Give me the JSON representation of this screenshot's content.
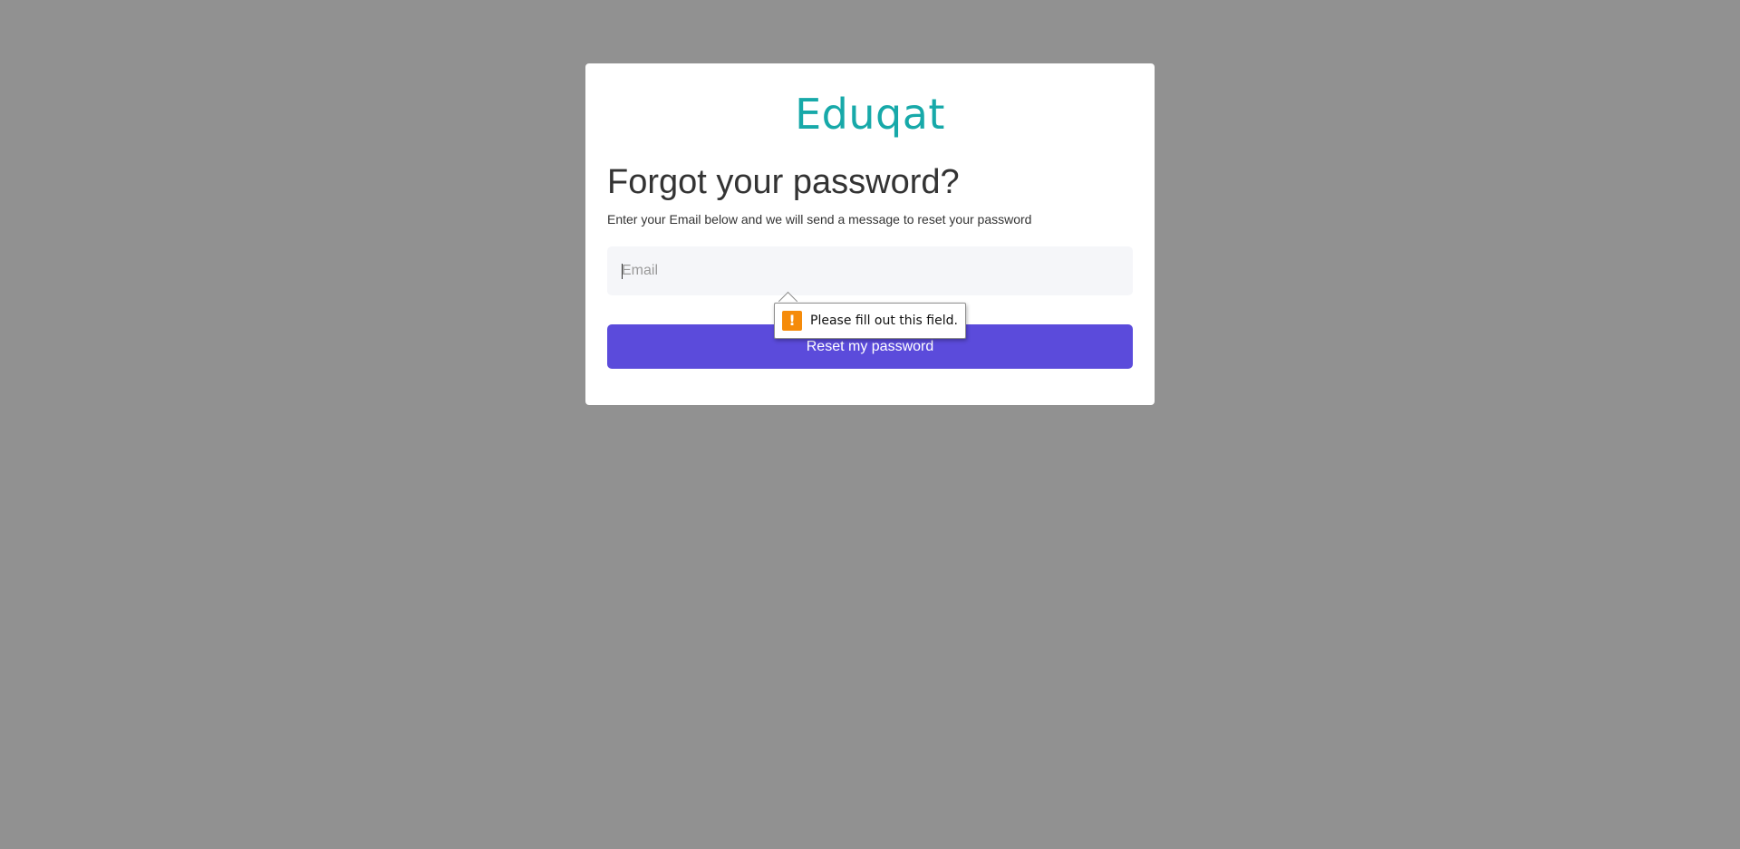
{
  "logo": {
    "text": "Eduqat"
  },
  "page": {
    "title": "Forgot your password?",
    "subtitle": "Enter your Email below and we will send a message to reset your password"
  },
  "form": {
    "email": {
      "value": "",
      "placeholder": "Email"
    },
    "submit_label": "Reset my password"
  },
  "validation": {
    "message": "Please fill out this field.",
    "icon": "warning-icon",
    "icon_glyph": "!"
  },
  "colors": {
    "background": "#919191",
    "brand": "#17a9a9",
    "primary_button": "#5b4bdb",
    "warning": "#f58b0a"
  }
}
